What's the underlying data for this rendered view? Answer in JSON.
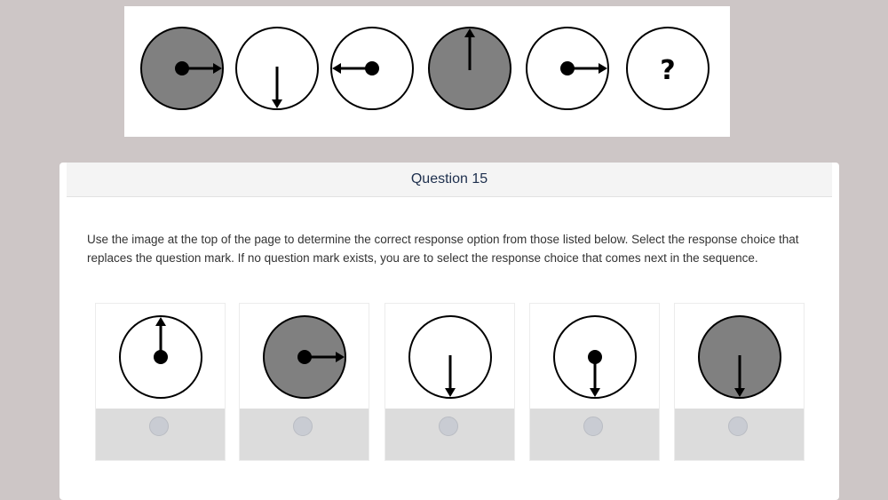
{
  "sequence": {
    "figures": [
      {
        "name": "gray-circle-arrow-right",
        "fill": "gray",
        "dot": true,
        "arrow": "right"
      },
      {
        "name": "white-circle-arrow-down",
        "fill": "white",
        "dot": false,
        "arrow": "down"
      },
      {
        "name": "white-circle-arrow-left",
        "fill": "white",
        "dot": true,
        "arrow": "left"
      },
      {
        "name": "gray-circle-arrow-up",
        "fill": "gray",
        "dot": false,
        "arrow": "up"
      },
      {
        "name": "white-circle-arrow-right",
        "fill": "white",
        "dot": true,
        "arrow": "right"
      }
    ],
    "question_mark": "?"
  },
  "question": {
    "title": "Question 15",
    "instructions": "Use the image at the top of the page to determine the correct response option from those listed below. Select the response choice that replaces the question mark. If no question mark exists, you are to select the response choice that comes next in the sequence."
  },
  "options": [
    {
      "fill": "white",
      "dot": true,
      "arrow": "up"
    },
    {
      "fill": "gray",
      "dot": true,
      "arrow": "right"
    },
    {
      "fill": "white",
      "dot": false,
      "arrow": "down"
    },
    {
      "fill": "white",
      "dot": true,
      "arrow": "down"
    },
    {
      "fill": "gray",
      "dot": false,
      "arrow": "down"
    }
  ],
  "colors": {
    "gray_fill": "#808080",
    "white_fill": "#ffffff",
    "stroke": "#000000"
  }
}
